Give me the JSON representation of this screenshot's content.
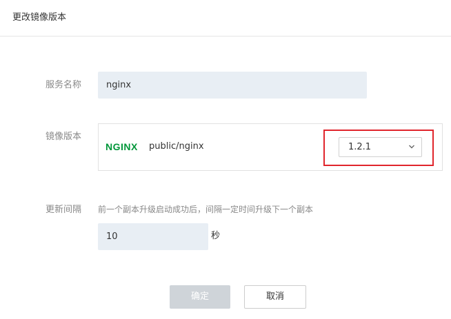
{
  "dialog": {
    "title": "更改镜像版本"
  },
  "form": {
    "service_name": {
      "label": "服务名称",
      "value": "nginx"
    },
    "image_version": {
      "label": "镜像版本",
      "logo_text": "NGINX",
      "image_name": "public/nginx",
      "selected_version": "1.2.1"
    },
    "update_interval": {
      "label": "更新间隔",
      "hint": "前一个副本升级启动成功后，间隔一定时间升级下一个副本",
      "value": "10",
      "unit": "秒"
    }
  },
  "buttons": {
    "confirm_label": "确定",
    "cancel_label": "取消"
  },
  "colors": {
    "highlight": "#e0242b",
    "nginx_green": "#009639",
    "input_bg": "#e8eef4",
    "disabled_button": "#cfd4d9"
  }
}
